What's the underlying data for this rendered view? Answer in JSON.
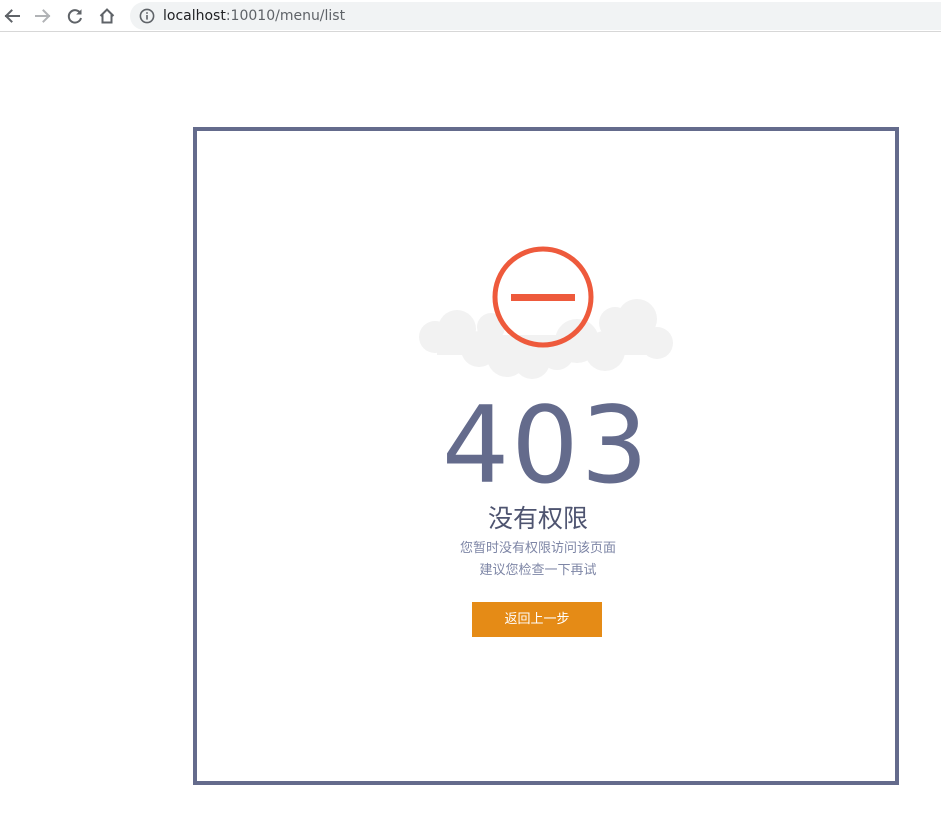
{
  "browser": {
    "back_icon": "arrow-left-icon",
    "forward_icon": "arrow-right-icon",
    "reload_icon": "reload-icon",
    "home_icon": "home-icon",
    "info_icon": "info-icon",
    "url_host": "localhost",
    "url_rest": ":10010/menu/list"
  },
  "error_page": {
    "illustration_icon": "no-entry-icon",
    "code": "403",
    "title": "没有权限",
    "description_line1": "您暂时没有权限访问该页面",
    "description_line2": "建议您检查一下再试",
    "back_button_label": "返回上一步"
  },
  "colors": {
    "frame_border": "#646b8c",
    "code_text": "#646b8c",
    "no_entry_red": "#ee5a3c",
    "button_orange": "#e58b16",
    "cloud": "#f2f2f2"
  }
}
